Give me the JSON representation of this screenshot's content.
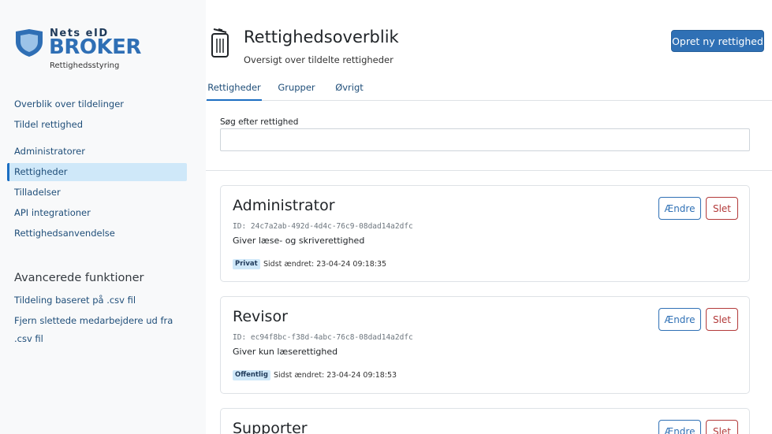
{
  "brand": {
    "top": "Nets eID",
    "name": "BROKER",
    "subtitle": "Rettighedsstyring",
    "colors": {
      "primary": "#2f6fb5",
      "dark": "#1f3a5a"
    }
  },
  "sidebar": {
    "group1": [
      {
        "label": "Overblik over tildelinger"
      },
      {
        "label": "Tildel rettighed"
      }
    ],
    "group2": [
      {
        "label": "Administratorer"
      },
      {
        "label": "Rettigheder",
        "active": true
      },
      {
        "label": "Tilladelser"
      },
      {
        "label": "API integrationer"
      },
      {
        "label": "Rettighedsanvendelse"
      }
    ],
    "advanced_heading": "Avancerede funktioner",
    "group3": [
      {
        "label": "Tildeling baseret på .csv fil"
      },
      {
        "label": "Fjern slettede medarbejdere ud fra .csv fil"
      }
    ]
  },
  "header": {
    "icon": "trash-can-icon",
    "title": "Rettighedsoverblik",
    "subtitle": "Oversigt over tildelte rettigheder",
    "create_button": "Opret ny rettighed"
  },
  "tabs": [
    {
      "label": "Rettigheder",
      "active": true
    },
    {
      "label": "Grupper"
    },
    {
      "label": "Øvrigt"
    }
  ],
  "search": {
    "label": "Søg efter rettighed",
    "value": "",
    "placeholder": ""
  },
  "cards": [
    {
      "title": "Administrator",
      "id": "ID: 24c7a2ab-492d-4d4c-76c9-08dad14a2dfc",
      "description": "Giver læse- og skriverettighed",
      "badge": "Privat",
      "modified": "Sidst ændret: 23-04-24 09:18:35",
      "edit_label": "Ændre",
      "delete_label": "Slet"
    },
    {
      "title": "Revisor",
      "id": "ID: ec94f8bc-f38d-4abc-76c8-08dad14a2dfc",
      "description": "Giver kun læserettighed",
      "badge": "Offentlig",
      "modified": "Sidst ændret: 23-04-24 09:18:53",
      "edit_label": "Ændre",
      "delete_label": "Slet"
    },
    {
      "title": "Supporter",
      "edit_label": "Ændre",
      "delete_label": "Slet"
    }
  ]
}
